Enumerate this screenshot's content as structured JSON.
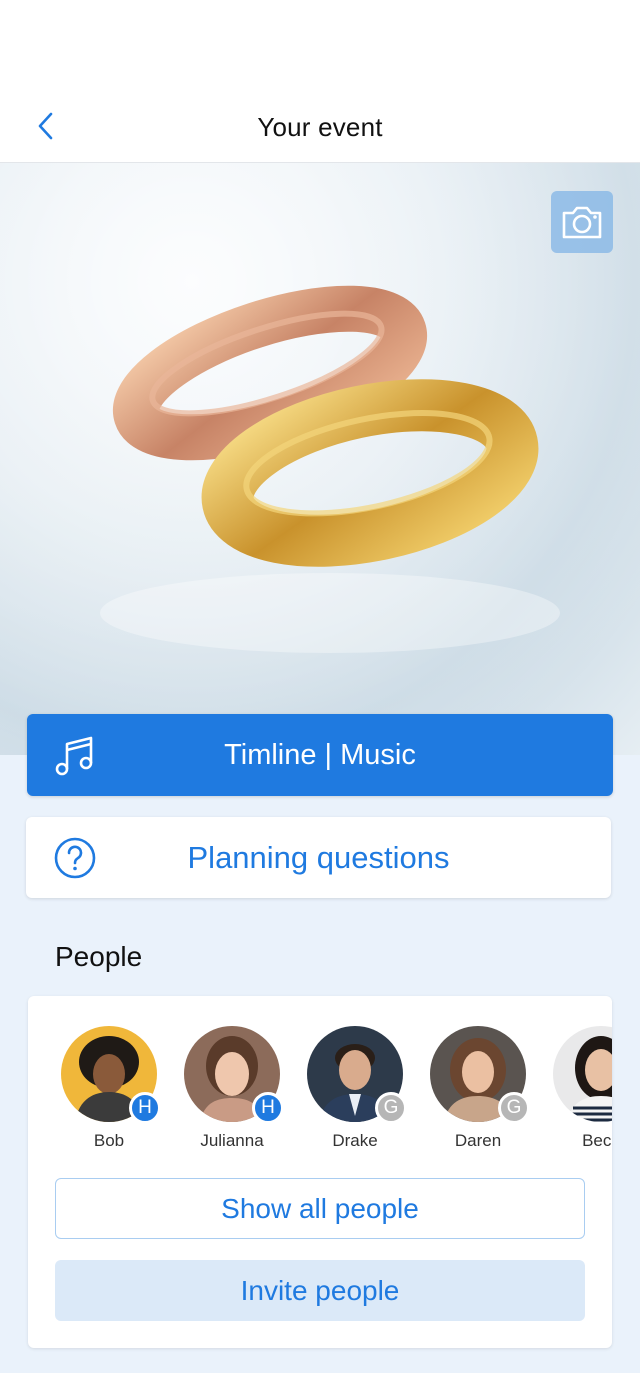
{
  "header": {
    "title": "Your event"
  },
  "actions": {
    "timeline_label": "Timline | Music",
    "planning_label": "Planning questions"
  },
  "people": {
    "section_title": "People",
    "list": [
      {
        "name": "Bob",
        "role_badge": "H",
        "badge_color": "#1f7ae0",
        "avatar_bg": "#f0b73a"
      },
      {
        "name": "Julianna",
        "role_badge": "H",
        "badge_color": "#1f7ae0",
        "avatar_bg": "#8c6b5a"
      },
      {
        "name": "Drake",
        "role_badge": "G",
        "badge_color": "#b6b6b6",
        "avatar_bg": "#2d3a4a"
      },
      {
        "name": "Daren",
        "role_badge": "G",
        "badge_color": "#b6b6b6",
        "avatar_bg": "#5a5450"
      },
      {
        "name": "Beck",
        "role_badge": "",
        "badge_color": "",
        "avatar_bg": "#e9e9ea"
      }
    ],
    "show_all_label": "Show all people",
    "invite_label": "Invite people"
  },
  "icons": {
    "back": "chevron-left-icon",
    "camera": "camera-icon",
    "music": "music-note-icon",
    "question": "question-circle-icon"
  },
  "colors": {
    "accent": "#1f7ae0",
    "accent_light": "#dbe9f8",
    "background": "#eaf2fb"
  }
}
